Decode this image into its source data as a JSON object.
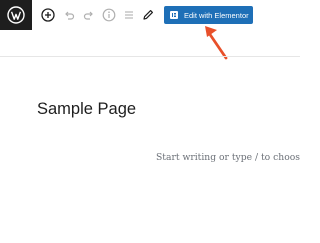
{
  "toolbar": {
    "logo_icon": "wordpress-icon",
    "add_icon": "plus-circle-icon",
    "undo_icon": "undo-icon",
    "redo_icon": "redo-icon",
    "info_icon": "info-icon",
    "outline_icon": "list-view-icon",
    "edit_icon": "pencil-icon",
    "elementor_button_label": "Edit with Elementor",
    "elementor_color": "#1e6fb7"
  },
  "annotation": {
    "arrow_color": "#e8502a"
  },
  "editor": {
    "page_title": "Sample Page",
    "block_placeholder": "Start writing or type / to choose a blo"
  }
}
